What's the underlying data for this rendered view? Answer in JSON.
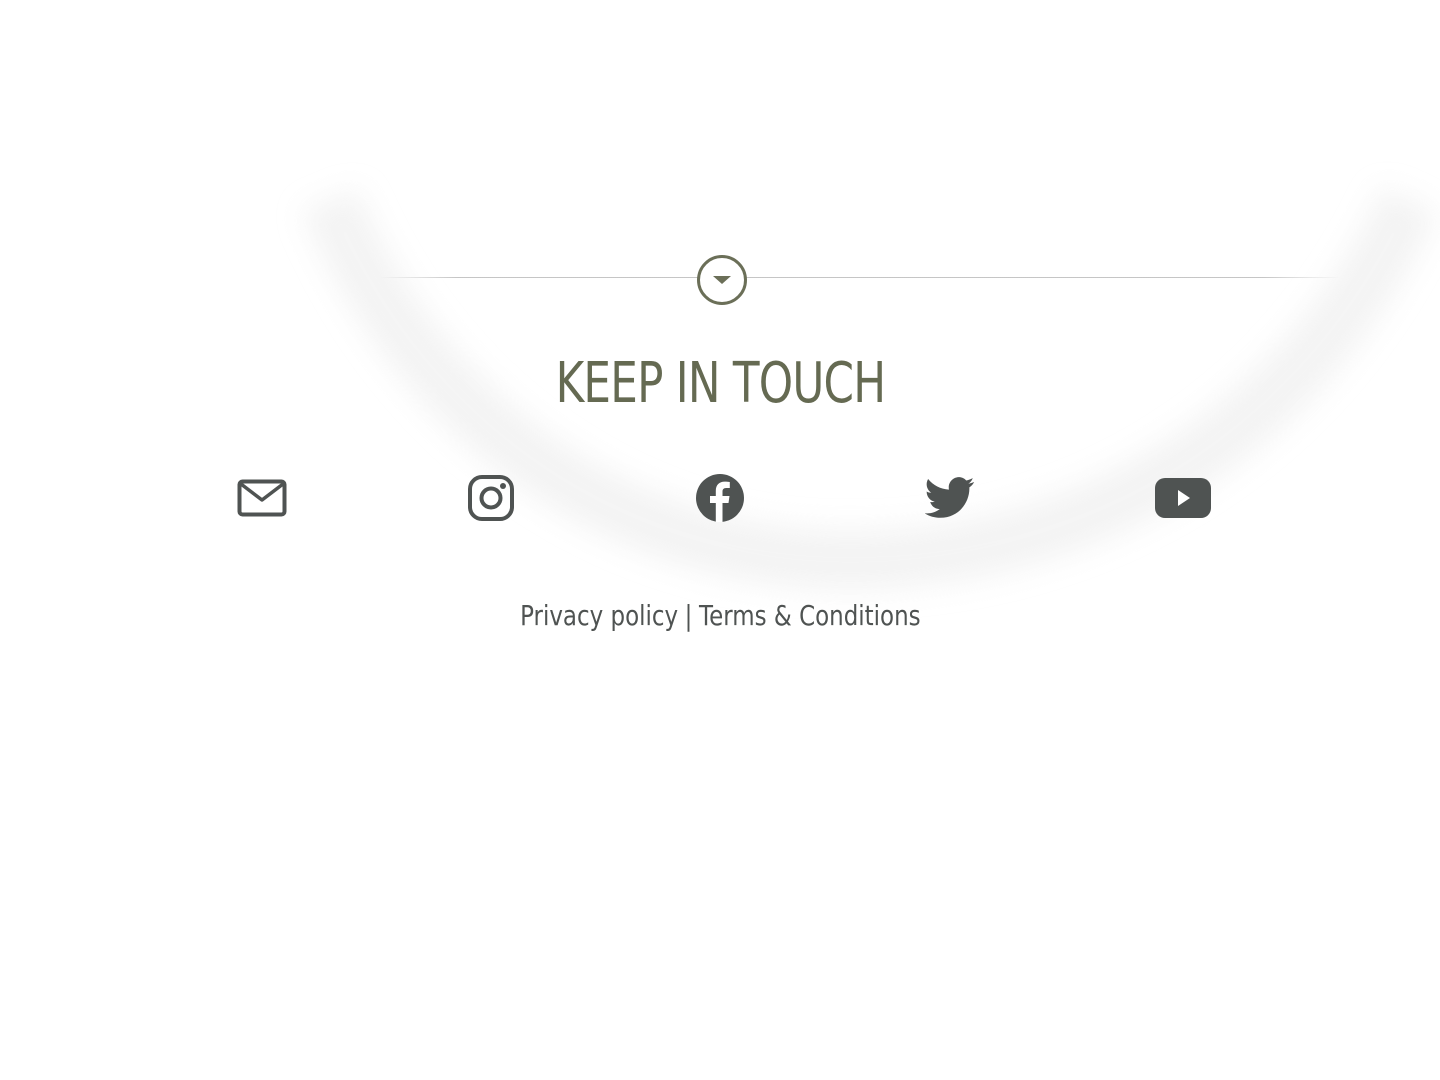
{
  "section": {
    "heading": "KEEP IN TOUCH"
  },
  "social": {
    "items": [
      {
        "icon": "mail-icon"
      },
      {
        "icon": "instagram-icon"
      },
      {
        "icon": "facebook-icon"
      },
      {
        "icon": "twitter-icon"
      },
      {
        "icon": "youtube-icon"
      }
    ]
  },
  "footer": {
    "privacy_label": "Privacy policy",
    "separator": "|",
    "terms_label": "Terms & Conditions"
  },
  "colors": {
    "heading": "#656a52",
    "icon": "#4f5352",
    "accent": "#6b6f58"
  }
}
